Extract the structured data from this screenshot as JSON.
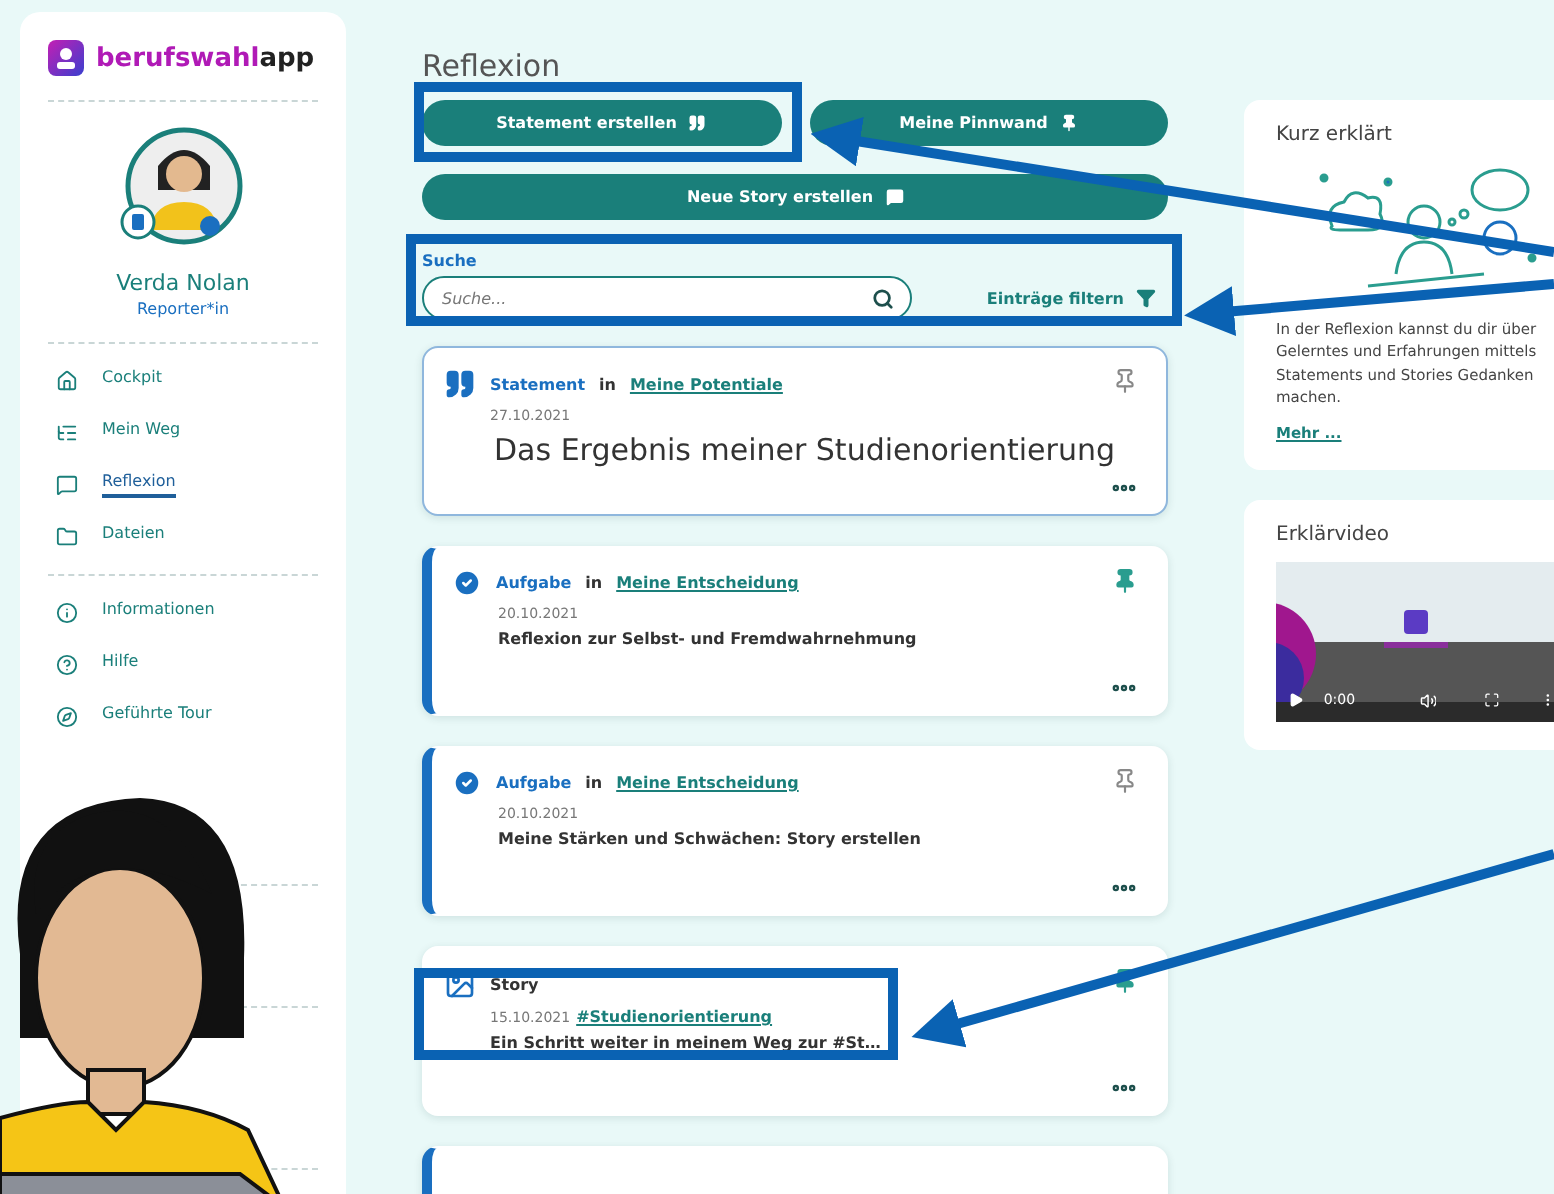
{
  "sidebar": {
    "logo": {
      "brand": "berufswahl",
      "suffix": "app"
    },
    "user": {
      "name": "Verda Nolan",
      "role": "Reporter*in"
    },
    "nav": [
      {
        "label": "Cockpit",
        "selected": false
      },
      {
        "label": "Mein Weg",
        "selected": false
      },
      {
        "label": "Reflexion",
        "selected": true
      },
      {
        "label": "Dateien",
        "selected": false
      }
    ],
    "nav_secondary": [
      {
        "label": "Informationen",
        "selected": false
      },
      {
        "label": "Hilfe",
        "selected": false
      },
      {
        "label": "Geführte Tour",
        "selected": false
      }
    ]
  },
  "page_title": "Reflexion",
  "actions": [
    "Statement erstellen",
    "Meine Pinnwand",
    "Neue Story erstellen"
  ],
  "search": {
    "label": "Suche",
    "placeholder": "Suche...",
    "filter": "Einträge filtern"
  },
  "entries": [
    {
      "kind": "statement",
      "type": "Statement",
      "joiner": "in",
      "category": "Meine Potentiale",
      "date": "27.10.2021",
      "title": "Das Ergebnis meiner Studienorientierung",
      "pinned": false,
      "selected": true
    },
    {
      "kind": "task",
      "type": "Aufgabe",
      "joiner": "in",
      "category": "Meine Entscheidung",
      "date": "20.10.2021",
      "title": "Reflexion zur Selbst- und Fremdwahrnehmung",
      "pinned": true,
      "selected": false
    },
    {
      "kind": "task",
      "type": "Aufgabe",
      "joiner": "in",
      "category": "Meine Entscheidung",
      "date": "20.10.2021",
      "title": "Meine Stärken und Schwächen: Story erstellen",
      "pinned": false,
      "selected": false
    },
    {
      "kind": "story",
      "type": "Story",
      "date": "15.10.2021",
      "tag": "#Studienorientierung",
      "title": "Ein Schritt weiter in meinem Weg zur #St…",
      "pinned": true,
      "selected": false
    }
  ],
  "info": {
    "title": "Kurz erklärt",
    "text": "In der Reflexion kannst du dir über Gelerntes und Erfahrungen mittels Statements und Stories Gedanken machen.",
    "link": "Mehr ..."
  },
  "video": {
    "title": "Erklärvideo",
    "time": "0:00"
  }
}
